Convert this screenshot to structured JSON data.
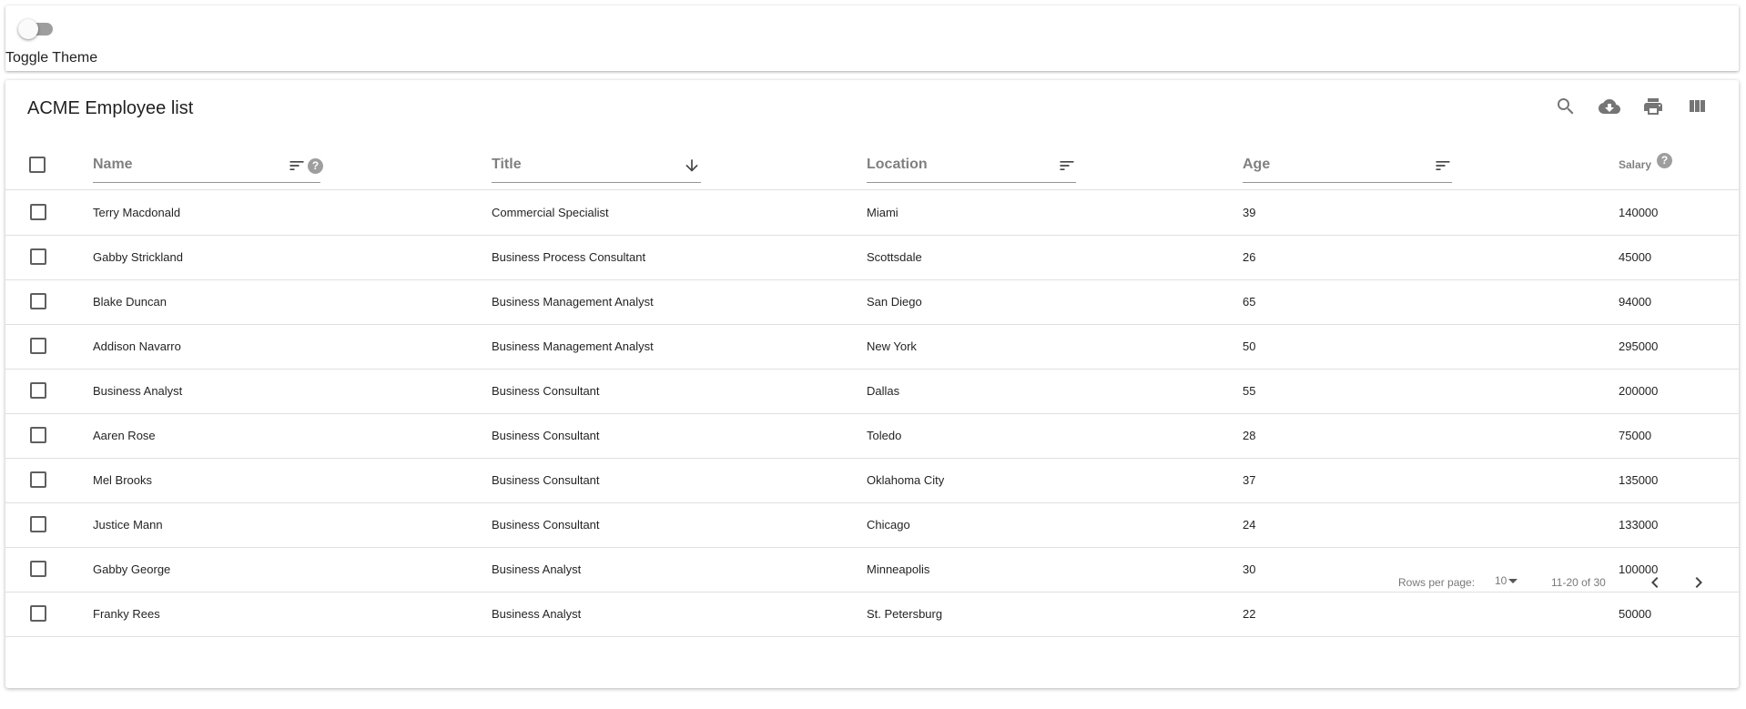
{
  "theme": {
    "toggle_label": "Toggle Theme"
  },
  "table": {
    "title": "ACME Employee list",
    "toolbar": {
      "search_icon": "search-icon",
      "download_icon": "cloud-download-icon",
      "print_icon": "print-icon",
      "columns_icon": "view-columns-icon"
    },
    "columns": [
      {
        "label": "Name"
      },
      {
        "label": "Title"
      },
      {
        "label": "Location"
      },
      {
        "label": "Age"
      },
      {
        "label": "Salary"
      }
    ],
    "help_glyph": "?",
    "rows": [
      {
        "name": "Terry Macdonald",
        "title": "Commercial Specialist",
        "location": "Miami",
        "age": "39",
        "salary": "140000"
      },
      {
        "name": "Gabby Strickland",
        "title": "Business Process Consultant",
        "location": "Scottsdale",
        "age": "26",
        "salary": "45000"
      },
      {
        "name": "Blake Duncan",
        "title": "Business Management Analyst",
        "location": "San Diego",
        "age": "65",
        "salary": "94000"
      },
      {
        "name": "Addison Navarro",
        "title": "Business Management Analyst",
        "location": "New York",
        "age": "50",
        "salary": "295000"
      },
      {
        "name": "Business Analyst",
        "title": "Business Consultant",
        "location": "Dallas",
        "age": "55",
        "salary": "200000"
      },
      {
        "name": "Aaren Rose",
        "title": "Business Consultant",
        "location": "Toledo",
        "age": "28",
        "salary": "75000"
      },
      {
        "name": "Mel Brooks",
        "title": "Business Consultant",
        "location": "Oklahoma City",
        "age": "37",
        "salary": "135000"
      },
      {
        "name": "Justice Mann",
        "title": "Business Consultant",
        "location": "Chicago",
        "age": "24",
        "salary": "133000"
      },
      {
        "name": "Gabby George",
        "title": "Business Analyst",
        "location": "Minneapolis",
        "age": "30",
        "salary": "100000"
      },
      {
        "name": "Franky Rees",
        "title": "Business Analyst",
        "location": "St. Petersburg",
        "age": "22",
        "salary": "50000"
      }
    ],
    "pagination": {
      "rows_per_page_label": "Rows per page:",
      "rows_per_page_value": "10",
      "range_text": "11-20 of 30"
    }
  },
  "colors": {
    "icon": "#757575",
    "divider": "#e0e0e0",
    "checkbox_border": "#5f5f5f"
  }
}
